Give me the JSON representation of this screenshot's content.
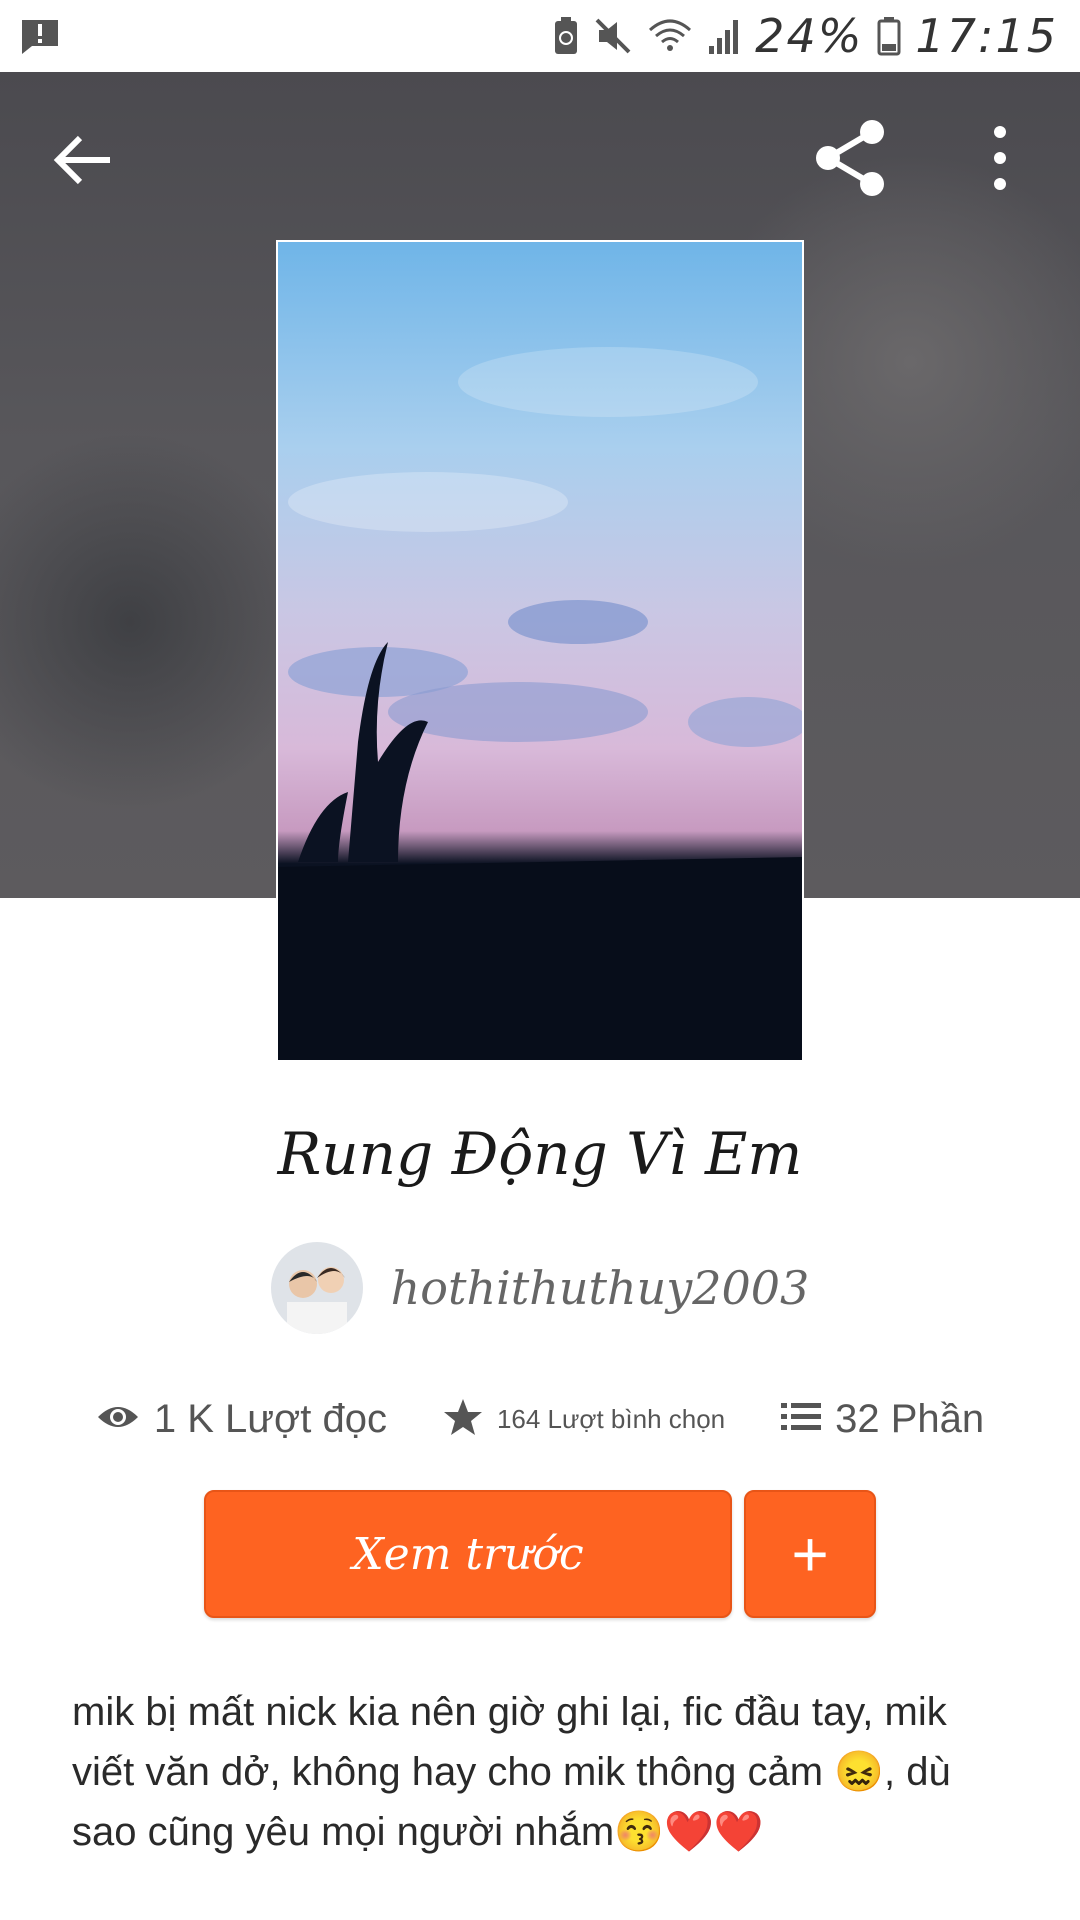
{
  "status_bar": {
    "battery_percent": "24%",
    "time": "17:15",
    "icons": [
      "alert-message-icon",
      "recycle-battery-icon",
      "mute-vibrate-icon",
      "wifi-icon",
      "signal-icon",
      "battery-icon"
    ]
  },
  "toolbar": {
    "back_icon": "arrow-left-icon",
    "share_icon": "share-icon",
    "more_icon": "more-vertical-icon"
  },
  "story": {
    "title": "Rung Động Vì Em",
    "author": "hothithuthuy2003",
    "reads": "1 K Lượt đọc",
    "votes": "164 Lượt bình chọn",
    "parts": "32 Phần",
    "preview_button": "Xem trước",
    "add_button": "+",
    "description": "mik bị mất nick kia nên giờ ghi lại, fic đầu tay, mik viết văn dở, không hay cho mik thông cảm 😖, dù sao cũng yêu mọi người nhắm😚❤️❤️"
  },
  "colors": {
    "accent": "#fe6321",
    "hero_background": "#555458"
  }
}
